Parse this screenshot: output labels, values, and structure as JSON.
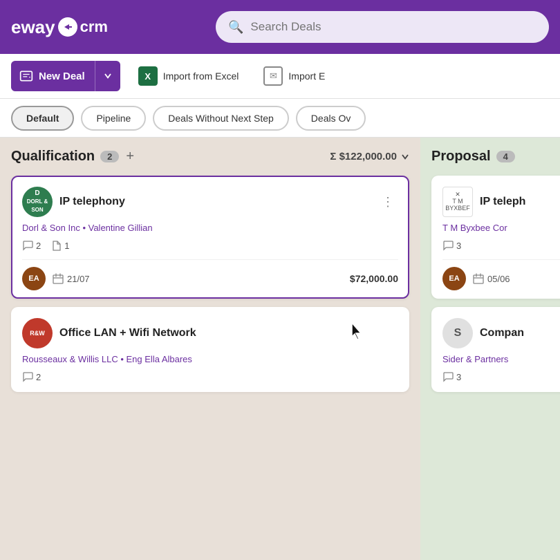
{
  "header": {
    "logo_eway": "eway",
    "logo_crm": "crm",
    "search_placeholder": "Search Deals"
  },
  "toolbar": {
    "new_deal_label": "New Deal",
    "import_excel_label": "Import from Excel",
    "import_email_label": "Import E"
  },
  "tabs": [
    {
      "id": "default",
      "label": "Default",
      "active": true
    },
    {
      "id": "pipeline",
      "label": "Pipeline",
      "active": false
    },
    {
      "id": "deals-without-next-step",
      "label": "Deals Without Next Step",
      "active": false
    },
    {
      "id": "deals-ov",
      "label": "Deals Ov",
      "active": false
    }
  ],
  "columns": [
    {
      "id": "qualification",
      "title": "Qualification",
      "count": "2",
      "sum": "Σ $122,000.00",
      "deals": [
        {
          "id": "deal-1",
          "avatar_initials": "D",
          "avatar_color": "#2e7d4f",
          "avatar_label": "DORL & SON",
          "title": "IP telephony",
          "company": "Dorl & Son Inc",
          "person": "Valentine Gillian",
          "comments": "2",
          "files": "1",
          "footer_avatar_initials": "EA",
          "footer_avatar_color": "#8b4513",
          "date": "21/07",
          "amount": "$72,000.00",
          "selected": true
        },
        {
          "id": "deal-2",
          "avatar_initials": "",
          "avatar_color": "#c0392b",
          "avatar_label": "R&W",
          "title": "Office LAN + Wifi Network",
          "company": "Rousseaux & Willis LLC",
          "person": "Eng Ella Albares",
          "comments": "2",
          "files": "",
          "footer_avatar_initials": "",
          "footer_avatar_color": "",
          "date": "",
          "amount": "",
          "selected": false
        }
      ]
    },
    {
      "id": "proposal",
      "title": "Proposal",
      "count": "4",
      "sum": "",
      "deals": [
        {
          "id": "proposal-deal-1",
          "avatar_initials": "T M BYXBEF",
          "avatar_color": "#fff",
          "title": "IP teleph",
          "company": "T M Byxbee Cor",
          "person": "",
          "comments": "3",
          "files": "",
          "footer_avatar_initials": "EA",
          "footer_avatar_color": "#8b4513",
          "date": "05/06",
          "amount": "",
          "selected": false
        },
        {
          "id": "proposal-deal-2",
          "avatar_initials": "S",
          "avatar_color": "#e0e0e0",
          "title": "Compan",
          "company": "Sider & Partners",
          "person": "",
          "comments": "3",
          "files": "",
          "footer_avatar_initials": "",
          "footer_avatar_color": "",
          "date": "",
          "amount": "",
          "selected": false
        }
      ]
    }
  ]
}
